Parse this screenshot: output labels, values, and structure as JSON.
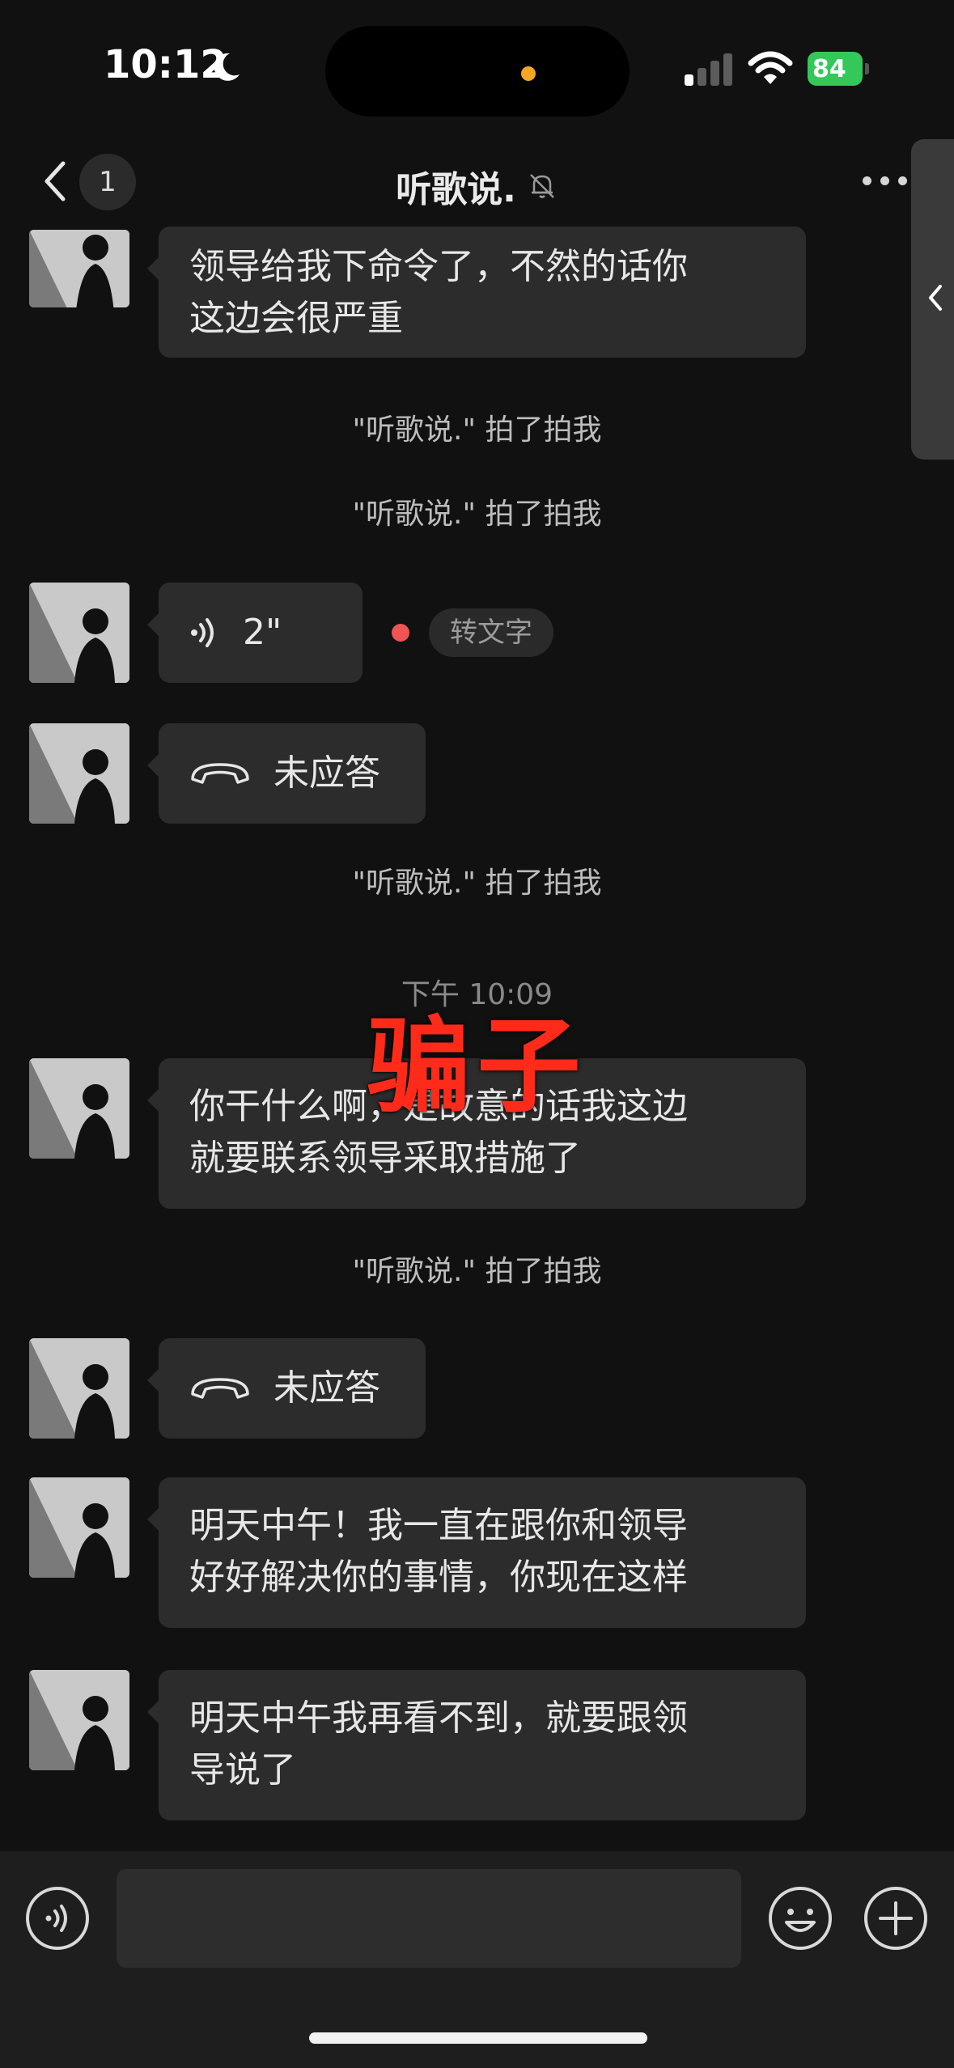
{
  "status_bar": {
    "time": "10:12",
    "battery": "84",
    "accent_battery": "#34c759",
    "island_indicator_color": "#f5a623",
    "icons": [
      "moon-icon",
      "signal-icon",
      "wifi-icon",
      "battery-icon"
    ]
  },
  "nav": {
    "unread_count": "1",
    "title": "听歌说.",
    "icons": [
      "back-icon",
      "mute-bell-icon",
      "more-icon"
    ]
  },
  "messages": [
    {
      "type": "text",
      "text_line1": "领导给我下命令了，不然的话你",
      "text_line2": "这边会很严重"
    },
    {
      "type": "system",
      "text": "\"听歌说.\" 拍了拍我"
    },
    {
      "type": "system",
      "text": "\"听歌说.\" 拍了拍我"
    },
    {
      "type": "voice",
      "duration": "2\"",
      "transcribe_label": "转文字",
      "unread_dot_color": "#f15454"
    },
    {
      "type": "call",
      "text": "未应答"
    },
    {
      "type": "system",
      "text": "\"听歌说.\" 拍了拍我"
    },
    {
      "type": "timestamp",
      "text": "下午 10:09"
    },
    {
      "type": "text",
      "text_line1": "你干什么啊，是故意的话我这边",
      "text_line2": "就要联系领导采取措施了"
    },
    {
      "type": "system",
      "text": "\"听歌说.\" 拍了拍我"
    },
    {
      "type": "call",
      "text": "未应答"
    },
    {
      "type": "text",
      "text_line1": "明天中午！我一直在跟你和领导",
      "text_line2": "好好解决你的事情，你现在这样"
    },
    {
      "type": "text",
      "text_line1": "明天中午我再看不到，就要跟领",
      "text_line2": "导说了"
    }
  ],
  "overlay": {
    "watermark": "骗子",
    "color": "#ff2b1a"
  },
  "input_bar": {
    "placeholder": "",
    "icons": [
      "voice-toggle-icon",
      "emoji-icon",
      "plus-icon"
    ]
  }
}
